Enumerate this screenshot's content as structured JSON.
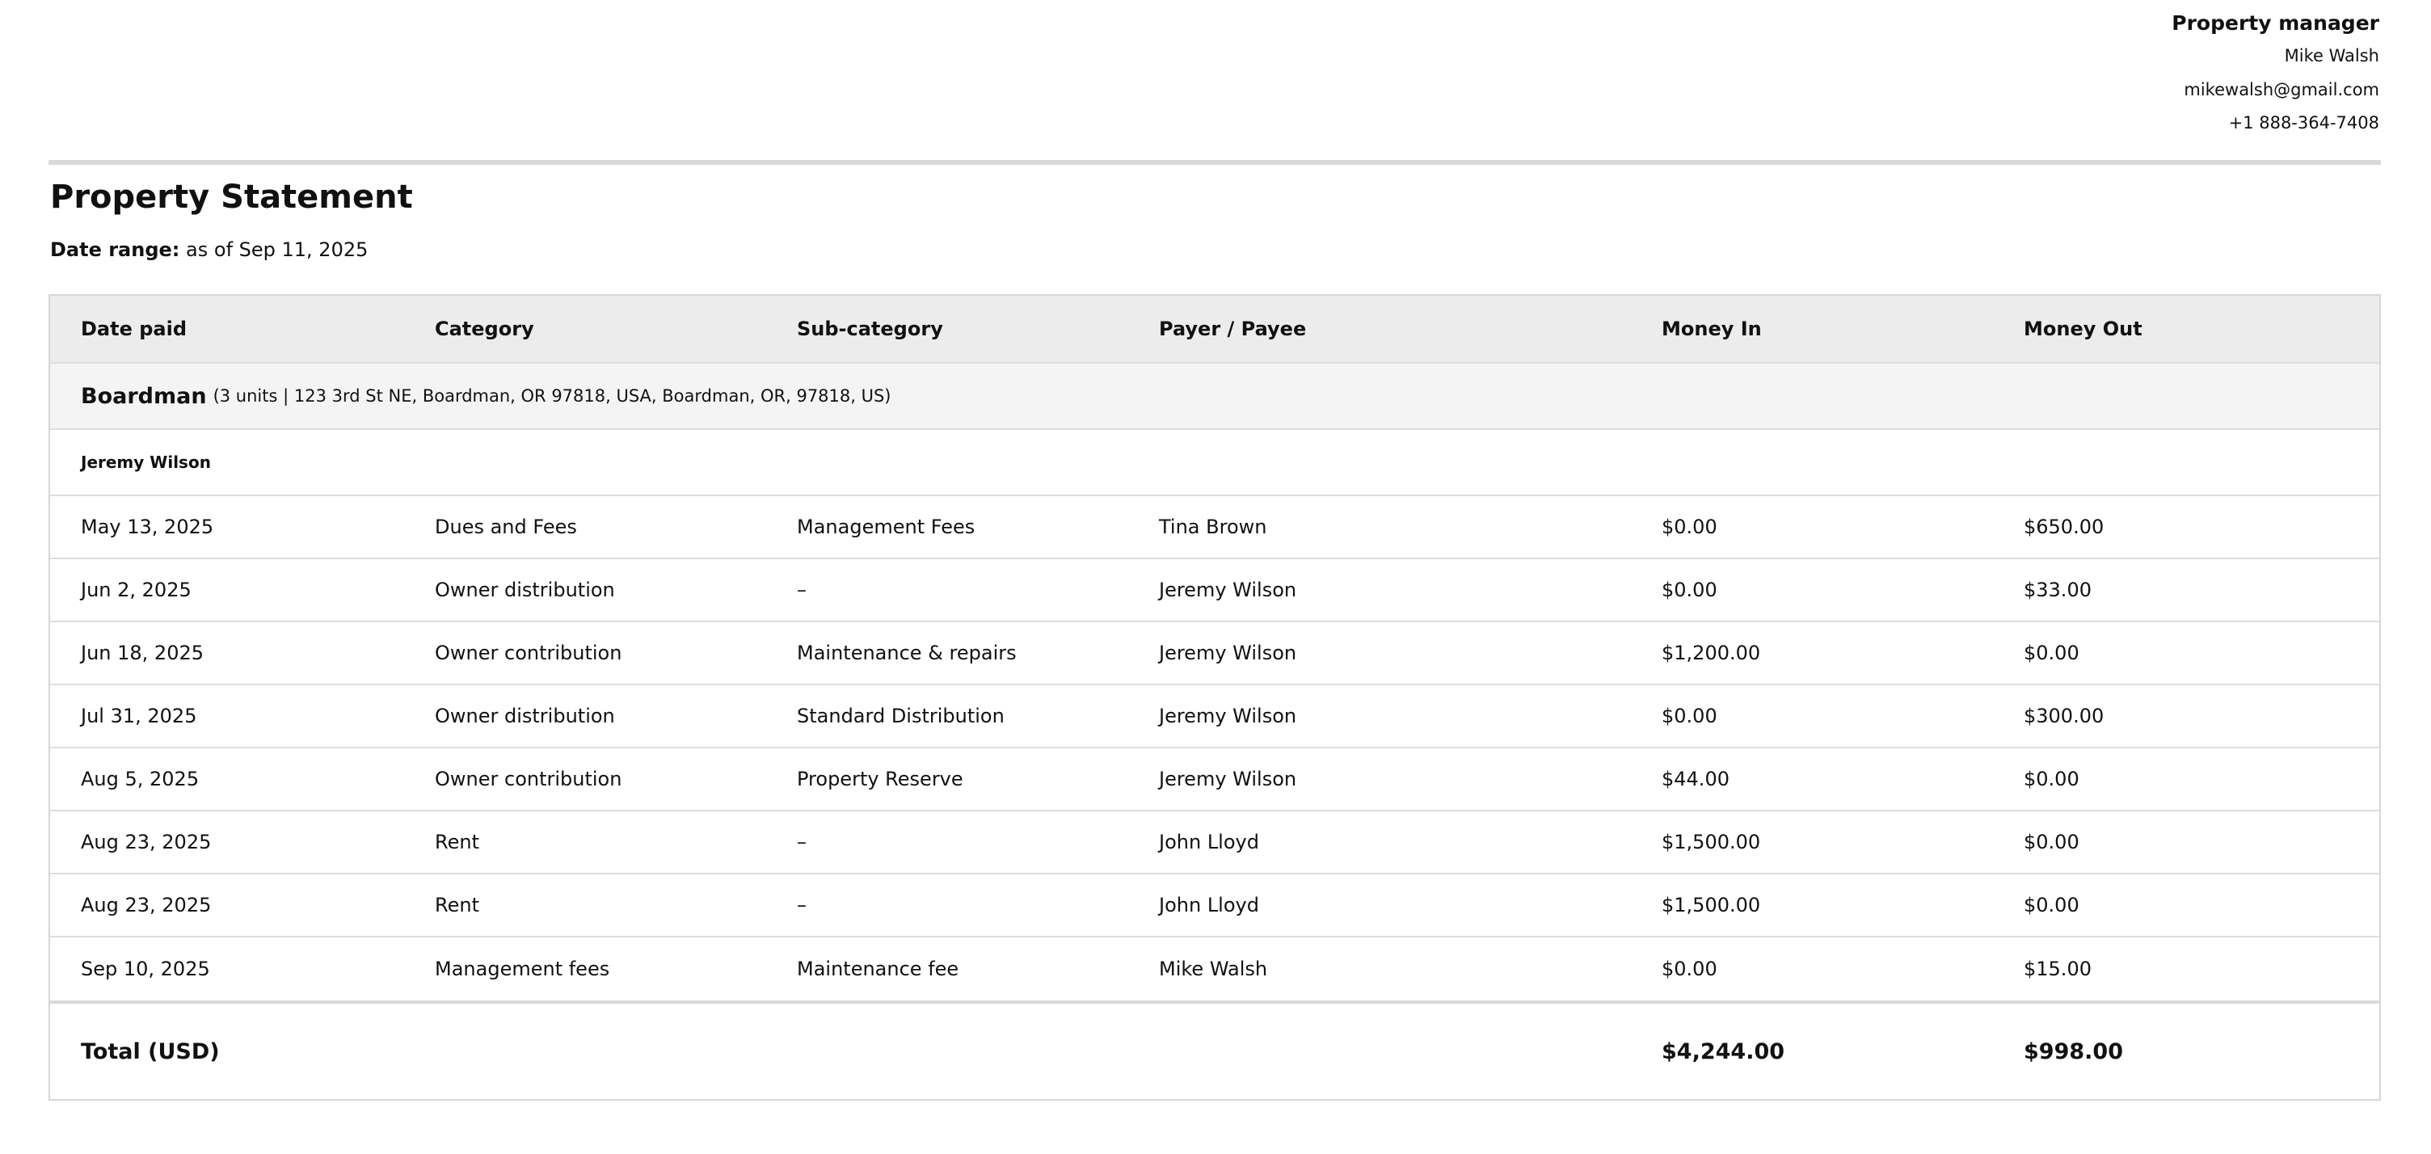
{
  "manager": {
    "title": "Property manager",
    "name": "Mike Walsh",
    "email": "mikewalsh@gmail.com",
    "phone": "+1 888-364-7408"
  },
  "statement": {
    "title": "Property Statement",
    "date_range_label": "Date range:",
    "date_range_value": "as of Sep 11, 2025"
  },
  "table": {
    "headers": [
      "Date paid",
      "Category",
      "Sub-category",
      "Payer / Payee",
      "Money In",
      "Money Out"
    ],
    "property": {
      "name": "Boardman",
      "details": "(3 units | 123 3rd St NE, Boardman, OR 97818, USA, Boardman, OR, 97818, US)"
    },
    "owner": "Jeremy Wilson",
    "rows": [
      [
        "May 13, 2025",
        "Dues and Fees",
        "Management Fees",
        "Tina Brown",
        "$0.00",
        "$650.00"
      ],
      [
        "Jun 2, 2025",
        "Owner distribution",
        "–",
        "Jeremy Wilson",
        "$0.00",
        "$33.00"
      ],
      [
        "Jun 18, 2025",
        "Owner contribution",
        "Maintenance & repairs",
        "Jeremy Wilson",
        "$1,200.00",
        "$0.00"
      ],
      [
        "Jul 31, 2025",
        "Owner distribution",
        "Standard Distribution",
        "Jeremy Wilson",
        "$0.00",
        "$300.00"
      ],
      [
        "Aug 5, 2025",
        "Owner contribution",
        "Property Reserve",
        "Jeremy Wilson",
        "$44.00",
        "$0.00"
      ],
      [
        "Aug 23, 2025",
        "Rent",
        "–",
        "John Lloyd",
        "$1,500.00",
        "$0.00"
      ],
      [
        "Aug 23, 2025",
        "Rent",
        "–",
        "John Lloyd",
        "$1,500.00",
        "$0.00"
      ],
      [
        "Sep 10, 2025",
        "Management fees",
        "Maintenance fee",
        "Mike Walsh",
        "$0.00",
        "$15.00"
      ]
    ],
    "total": {
      "label": "Total (USD)",
      "money_in": "$4,244.00",
      "money_out": "$998.00"
    }
  }
}
